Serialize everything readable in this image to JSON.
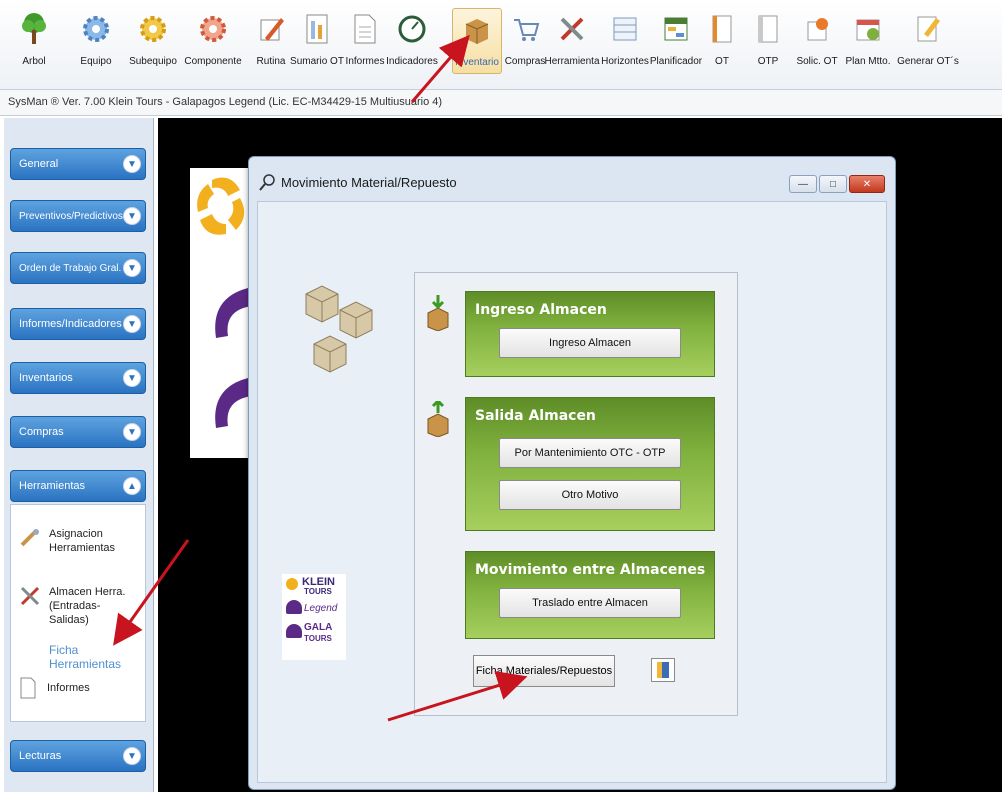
{
  "toolbar": {
    "items": [
      {
        "label": "Arbol",
        "icon": "tree-icon"
      },
      {
        "label": "Equipo",
        "icon": "gear-blue-icon"
      },
      {
        "label": "Subequipo",
        "icon": "gear-yellow-icon"
      },
      {
        "label": "Componente",
        "icon": "gear-red-icon"
      },
      {
        "label": "Rutina",
        "icon": "pencil-icon"
      },
      {
        "label": "Sumario OT",
        "icon": "sumario-icon"
      },
      {
        "label": "Informes",
        "icon": "document-icon"
      },
      {
        "label": "Indicadores",
        "icon": "gauge-icon"
      },
      {
        "label": "Inventario",
        "icon": "box-icon"
      },
      {
        "label": "Compras",
        "icon": "cart-icon"
      },
      {
        "label": "Herramienta",
        "icon": "tools-icon"
      },
      {
        "label": "Horizontes",
        "icon": "horizon-icon"
      },
      {
        "label": "Planificador",
        "icon": "planner-icon"
      },
      {
        "label": "OT",
        "icon": "ot-icon"
      },
      {
        "label": "OTP",
        "icon": "otp-icon"
      },
      {
        "label": "Solic. OT",
        "icon": "request-icon"
      },
      {
        "label": "Plan Mtto.",
        "icon": "plan-icon"
      },
      {
        "label": "Generar OT´s",
        "icon": "generate-icon"
      }
    ]
  },
  "status_bar": "SysMan ® Ver. 7.00  Klein Tours - Galapagos Legend  (Lic. EC-M34429-15 Multiusuario 4)",
  "sidebar": {
    "sections": [
      {
        "label": "General"
      },
      {
        "label": "Preventivos/Predictivos"
      },
      {
        "label": "Orden de Trabajo Gral."
      },
      {
        "label": "Informes/Indicadores"
      },
      {
        "label": "Inventarios"
      },
      {
        "label": "Compras"
      },
      {
        "label": "Herramientas"
      },
      {
        "label": "Lecturas"
      }
    ],
    "herramientas_items": [
      {
        "label": "Asignacion Herramientas"
      },
      {
        "label": "Almacen Herra. (Entradas-Salidas)"
      },
      {
        "label": "Ficha Herramientas"
      },
      {
        "label": "Informes"
      }
    ]
  },
  "dialog": {
    "title": "Movimiento Material/Repuesto",
    "ingreso": {
      "title": "Ingreso Almacen",
      "button": "Ingreso Almacen"
    },
    "salida": {
      "title": "Salida Almacen",
      "button1": "Por Mantenimiento OTC - OTP",
      "button2": "Otro Motivo"
    },
    "movimiento": {
      "title": "Movimiento entre Almacenes",
      "button": "Traslado entre Almacen"
    },
    "footer_button": "Ficha Materiales/Repuestos"
  },
  "logo": {
    "line1": "KLEIN",
    "line2": "TOURS",
    "line3": "Legend",
    "line4": "GALA",
    "line5": "TOURS"
  },
  "colors": {
    "accent_green": "#7fb03d",
    "sidebar_blue": "#2a73c2",
    "arrow_red": "#c8141e"
  }
}
